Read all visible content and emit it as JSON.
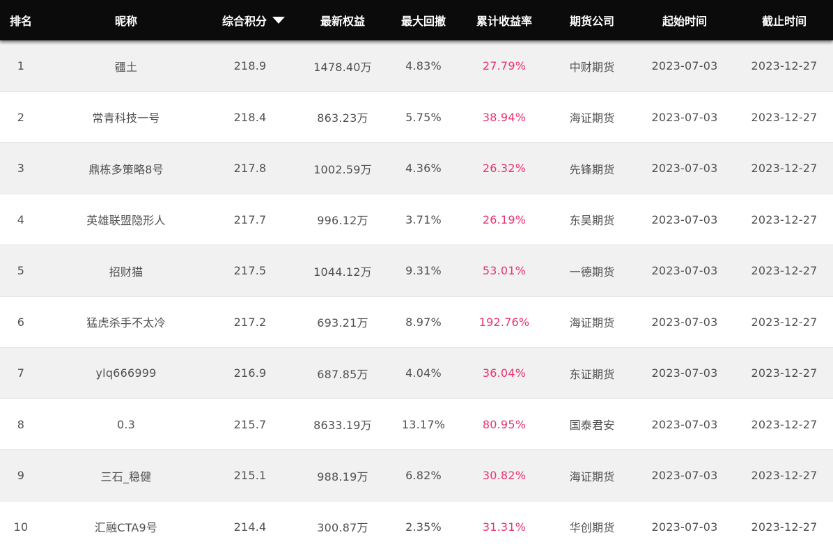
{
  "header": {
    "rank": "排名",
    "nickname": "昵称",
    "score": "综合积分",
    "equity": "最新权益",
    "max_drawdown": "最大回撤",
    "cum_return": "累计收益率",
    "broker": "期货公司",
    "start_date": "起始时间",
    "end_date": "截止时间",
    "sort_icon": "caret-down"
  },
  "colors": {
    "header_bg": "#0b0b0b",
    "return_text": "#e8336d",
    "row_alt_bg": "#f1f1f1"
  },
  "rows": [
    {
      "rank": "1",
      "name": "疆土",
      "score": "218.9",
      "equity": "1478.40万",
      "dd": "4.83%",
      "ret": "27.79%",
      "broker": "中财期货",
      "start": "2023-07-03",
      "end": "2023-12-27"
    },
    {
      "rank": "2",
      "name": "常青科技一号",
      "score": "218.4",
      "equity": "863.23万",
      "dd": "5.75%",
      "ret": "38.94%",
      "broker": "海证期货",
      "start": "2023-07-03",
      "end": "2023-12-27"
    },
    {
      "rank": "3",
      "name": "鼎栋多策略8号",
      "score": "217.8",
      "equity": "1002.59万",
      "dd": "4.36%",
      "ret": "26.32%",
      "broker": "先锋期货",
      "start": "2023-07-03",
      "end": "2023-12-27"
    },
    {
      "rank": "4",
      "name": "英雄联盟隐形人",
      "score": "217.7",
      "equity": "996.12万",
      "dd": "3.71%",
      "ret": "26.19%",
      "broker": "东吴期货",
      "start": "2023-07-03",
      "end": "2023-12-27"
    },
    {
      "rank": "5",
      "name": "招财猫",
      "score": "217.5",
      "equity": "1044.12万",
      "dd": "9.31%",
      "ret": "53.01%",
      "broker": "一德期货",
      "start": "2023-07-03",
      "end": "2023-12-27"
    },
    {
      "rank": "6",
      "name": "猛虎杀手不太冷",
      "score": "217.2",
      "equity": "693.21万",
      "dd": "8.97%",
      "ret": "192.76%",
      "broker": "海证期货",
      "start": "2023-07-03",
      "end": "2023-12-27"
    },
    {
      "rank": "7",
      "name": "ylq666999",
      "score": "216.9",
      "equity": "687.85万",
      "dd": "4.04%",
      "ret": "36.04%",
      "broker": "东证期货",
      "start": "2023-07-03",
      "end": "2023-12-27"
    },
    {
      "rank": "8",
      "name": "0.3",
      "score": "215.7",
      "equity": "8633.19万",
      "dd": "13.17%",
      "ret": "80.95%",
      "broker": "国泰君安",
      "start": "2023-07-03",
      "end": "2023-12-27"
    },
    {
      "rank": "9",
      "name": "三石_稳健",
      "score": "215.1",
      "equity": "988.19万",
      "dd": "6.82%",
      "ret": "30.82%",
      "broker": "海证期货",
      "start": "2023-07-03",
      "end": "2023-12-27"
    },
    {
      "rank": "10",
      "name": "汇融CTA9号",
      "score": "214.4",
      "equity": "300.87万",
      "dd": "2.35%",
      "ret": "31.31%",
      "broker": "华创期货",
      "start": "2023-07-03",
      "end": "2023-12-27"
    }
  ]
}
